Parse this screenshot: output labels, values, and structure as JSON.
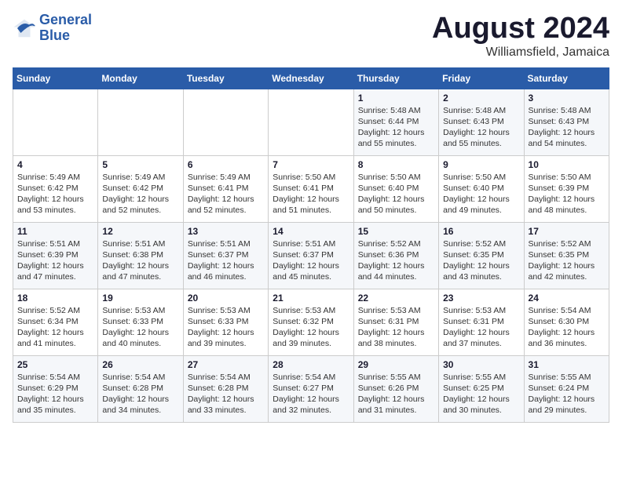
{
  "logo": {
    "line1": "General",
    "line2": "Blue"
  },
  "title": "August 2024",
  "location": "Williamsfield, Jamaica",
  "days_of_week": [
    "Sunday",
    "Monday",
    "Tuesday",
    "Wednesday",
    "Thursday",
    "Friday",
    "Saturday"
  ],
  "weeks": [
    [
      {
        "day": "",
        "info": ""
      },
      {
        "day": "",
        "info": ""
      },
      {
        "day": "",
        "info": ""
      },
      {
        "day": "",
        "info": ""
      },
      {
        "day": "1",
        "info": "Sunrise: 5:48 AM\nSunset: 6:44 PM\nDaylight: 12 hours\nand 55 minutes."
      },
      {
        "day": "2",
        "info": "Sunrise: 5:48 AM\nSunset: 6:43 PM\nDaylight: 12 hours\nand 55 minutes."
      },
      {
        "day": "3",
        "info": "Sunrise: 5:48 AM\nSunset: 6:43 PM\nDaylight: 12 hours\nand 54 minutes."
      }
    ],
    [
      {
        "day": "4",
        "info": "Sunrise: 5:49 AM\nSunset: 6:42 PM\nDaylight: 12 hours\nand 53 minutes."
      },
      {
        "day": "5",
        "info": "Sunrise: 5:49 AM\nSunset: 6:42 PM\nDaylight: 12 hours\nand 52 minutes."
      },
      {
        "day": "6",
        "info": "Sunrise: 5:49 AM\nSunset: 6:41 PM\nDaylight: 12 hours\nand 52 minutes."
      },
      {
        "day": "7",
        "info": "Sunrise: 5:50 AM\nSunset: 6:41 PM\nDaylight: 12 hours\nand 51 minutes."
      },
      {
        "day": "8",
        "info": "Sunrise: 5:50 AM\nSunset: 6:40 PM\nDaylight: 12 hours\nand 50 minutes."
      },
      {
        "day": "9",
        "info": "Sunrise: 5:50 AM\nSunset: 6:40 PM\nDaylight: 12 hours\nand 49 minutes."
      },
      {
        "day": "10",
        "info": "Sunrise: 5:50 AM\nSunset: 6:39 PM\nDaylight: 12 hours\nand 48 minutes."
      }
    ],
    [
      {
        "day": "11",
        "info": "Sunrise: 5:51 AM\nSunset: 6:39 PM\nDaylight: 12 hours\nand 47 minutes."
      },
      {
        "day": "12",
        "info": "Sunrise: 5:51 AM\nSunset: 6:38 PM\nDaylight: 12 hours\nand 47 minutes."
      },
      {
        "day": "13",
        "info": "Sunrise: 5:51 AM\nSunset: 6:37 PM\nDaylight: 12 hours\nand 46 minutes."
      },
      {
        "day": "14",
        "info": "Sunrise: 5:51 AM\nSunset: 6:37 PM\nDaylight: 12 hours\nand 45 minutes."
      },
      {
        "day": "15",
        "info": "Sunrise: 5:52 AM\nSunset: 6:36 PM\nDaylight: 12 hours\nand 44 minutes."
      },
      {
        "day": "16",
        "info": "Sunrise: 5:52 AM\nSunset: 6:35 PM\nDaylight: 12 hours\nand 43 minutes."
      },
      {
        "day": "17",
        "info": "Sunrise: 5:52 AM\nSunset: 6:35 PM\nDaylight: 12 hours\nand 42 minutes."
      }
    ],
    [
      {
        "day": "18",
        "info": "Sunrise: 5:52 AM\nSunset: 6:34 PM\nDaylight: 12 hours\nand 41 minutes."
      },
      {
        "day": "19",
        "info": "Sunrise: 5:53 AM\nSunset: 6:33 PM\nDaylight: 12 hours\nand 40 minutes."
      },
      {
        "day": "20",
        "info": "Sunrise: 5:53 AM\nSunset: 6:33 PM\nDaylight: 12 hours\nand 39 minutes."
      },
      {
        "day": "21",
        "info": "Sunrise: 5:53 AM\nSunset: 6:32 PM\nDaylight: 12 hours\nand 39 minutes."
      },
      {
        "day": "22",
        "info": "Sunrise: 5:53 AM\nSunset: 6:31 PM\nDaylight: 12 hours\nand 38 minutes."
      },
      {
        "day": "23",
        "info": "Sunrise: 5:53 AM\nSunset: 6:31 PM\nDaylight: 12 hours\nand 37 minutes."
      },
      {
        "day": "24",
        "info": "Sunrise: 5:54 AM\nSunset: 6:30 PM\nDaylight: 12 hours\nand 36 minutes."
      }
    ],
    [
      {
        "day": "25",
        "info": "Sunrise: 5:54 AM\nSunset: 6:29 PM\nDaylight: 12 hours\nand 35 minutes."
      },
      {
        "day": "26",
        "info": "Sunrise: 5:54 AM\nSunset: 6:28 PM\nDaylight: 12 hours\nand 34 minutes."
      },
      {
        "day": "27",
        "info": "Sunrise: 5:54 AM\nSunset: 6:28 PM\nDaylight: 12 hours\nand 33 minutes."
      },
      {
        "day": "28",
        "info": "Sunrise: 5:54 AM\nSunset: 6:27 PM\nDaylight: 12 hours\nand 32 minutes."
      },
      {
        "day": "29",
        "info": "Sunrise: 5:55 AM\nSunset: 6:26 PM\nDaylight: 12 hours\nand 31 minutes."
      },
      {
        "day": "30",
        "info": "Sunrise: 5:55 AM\nSunset: 6:25 PM\nDaylight: 12 hours\nand 30 minutes."
      },
      {
        "day": "31",
        "info": "Sunrise: 5:55 AM\nSunset: 6:24 PM\nDaylight: 12 hours\nand 29 minutes."
      }
    ]
  ]
}
